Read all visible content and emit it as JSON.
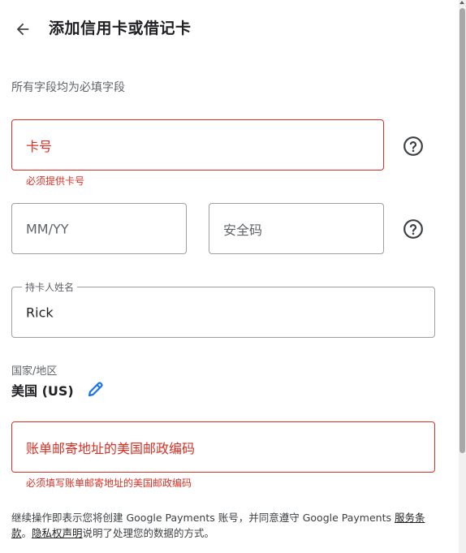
{
  "header": {
    "title": "添加信用卡或借记卡"
  },
  "required_note": "所有字段均为必填字段",
  "card_number": {
    "placeholder": "卡号",
    "error": "必须提供卡号"
  },
  "expiry": {
    "placeholder": "MM/YY"
  },
  "security_code": {
    "placeholder": "安全码"
  },
  "cardholder": {
    "label": "持卡人姓名",
    "value": "Rick"
  },
  "country": {
    "label": "国家/地区",
    "value": "美国 (US)"
  },
  "zip": {
    "placeholder": "账单邮寄地址的美国邮政编码",
    "error": "必须填写账单邮寄地址的美国邮政编码"
  },
  "footer": {
    "text_before": "继续操作即表示您将创建 Google Payments 账号，并同意遵守 Google Payments ",
    "terms_link": "服务条款",
    "separator": "。",
    "privacy_link": "隐私权声明",
    "text_after": "说明了处理您的数据的方式。"
  },
  "colors": {
    "error": "#d93025",
    "border": "#9aa0a6",
    "accent": "#1a73e8"
  },
  "icons": [
    "back-arrow-icon",
    "help-circle-icon",
    "pencil-icon"
  ]
}
